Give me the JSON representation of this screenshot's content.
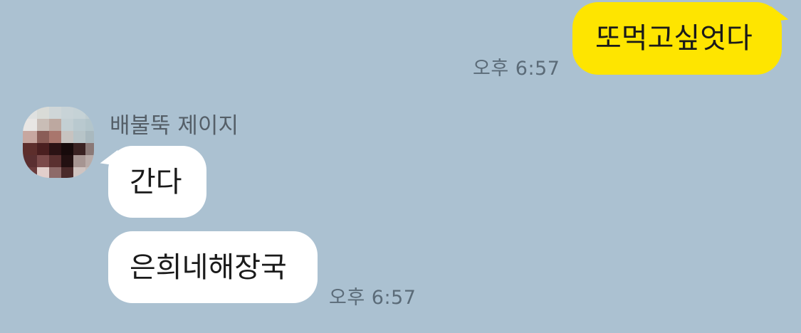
{
  "messages": [
    {
      "side": "me",
      "text": "또먹고싶엇다",
      "time": "오후 6:57"
    },
    {
      "side": "them",
      "sender": "배불뚝 제이지",
      "text": "간다"
    },
    {
      "side": "them",
      "text": "은희네해장국",
      "time": "오후 6:57"
    }
  ],
  "colors": {
    "background": "#abc1d1",
    "my_bubble": "#fee500",
    "their_bubble": "#ffffff"
  },
  "avatar": {
    "icon": "pixelated-profile-avatar"
  }
}
